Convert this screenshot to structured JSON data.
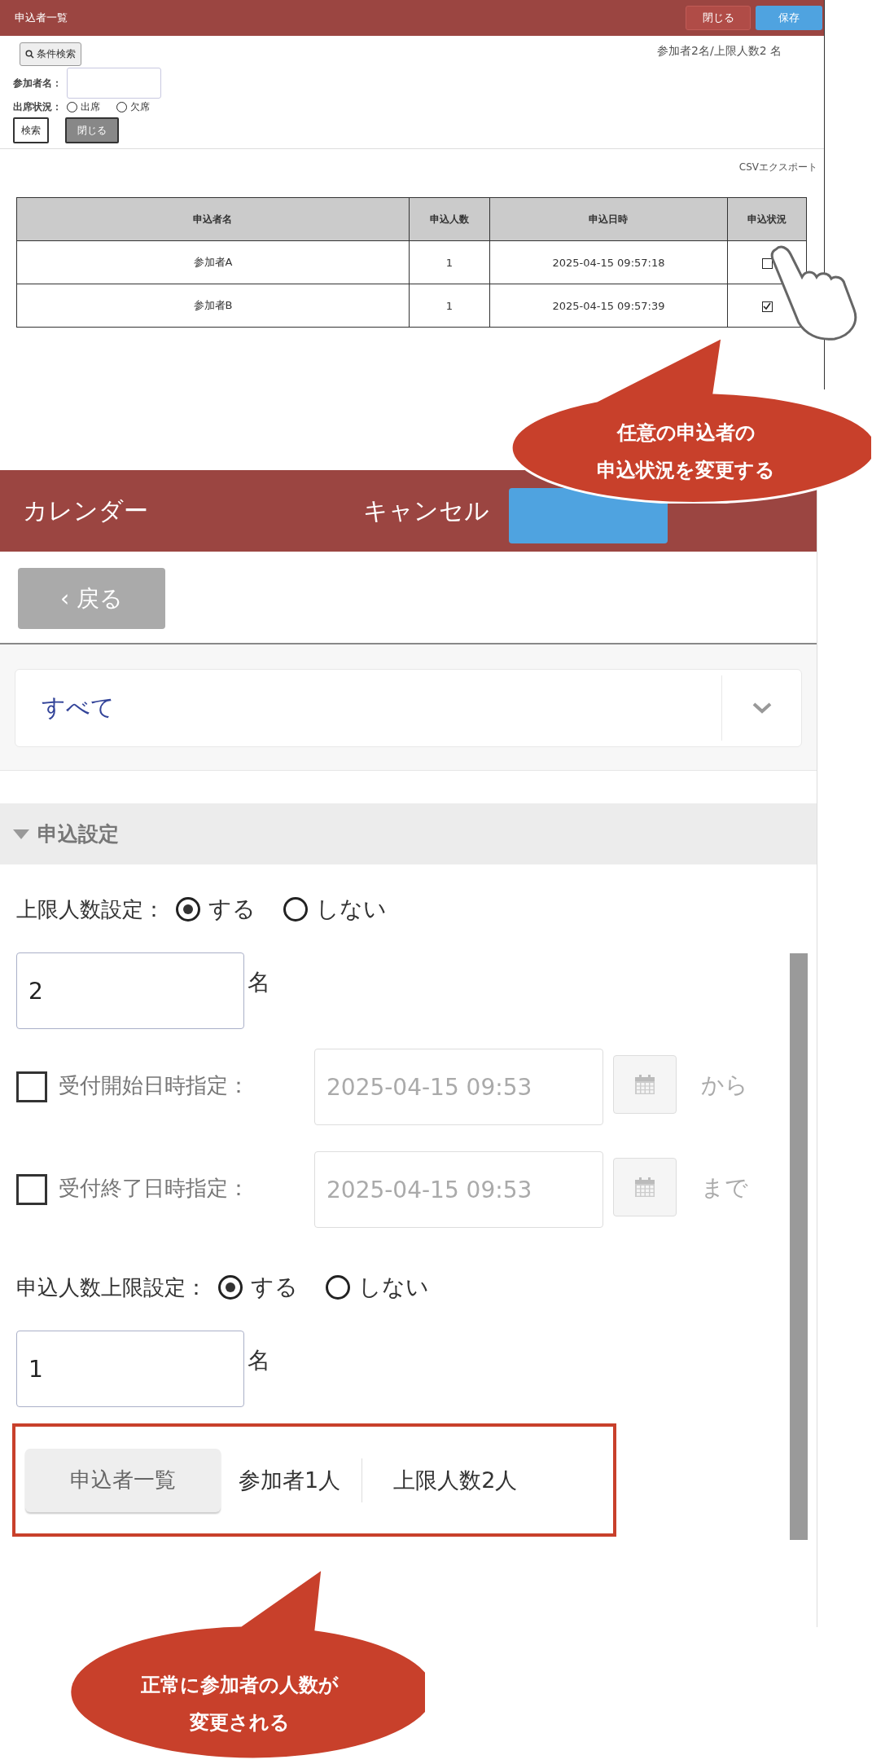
{
  "list_panel": {
    "title": "申込者一覧",
    "header_buttons": [
      {
        "label": "閉じる",
        "kind": "close"
      },
      {
        "label": "保存",
        "kind": "save"
      }
    ],
    "search_toggle": "条件検索",
    "summary": "参加者2名/上限人数2 名",
    "name_field": {
      "label": "参加者名："
    },
    "attendance": {
      "label": "出席状況：",
      "options": [
        {
          "label": "出席",
          "selected": false
        },
        {
          "label": "欠席",
          "selected": false
        }
      ]
    },
    "buttons": [
      {
        "label": "検索",
        "kind": "search"
      },
      {
        "label": "閉じる",
        "kind": "close"
      }
    ],
    "export_link": "CSVエクスポート",
    "table": {
      "columns": [
        "申込者名",
        "申込人数",
        "申込日時",
        "申込状況"
      ],
      "rows": [
        {
          "name": "参加者A",
          "count": "1",
          "datetime": "2025-04-15 09:57:18",
          "checked": false
        },
        {
          "name": "参加者B",
          "count": "1",
          "datetime": "2025-04-15 09:57:39",
          "checked": true
        }
      ]
    }
  },
  "calendar_panel": {
    "title": "カレンダー",
    "cancel": "キャンセル",
    "back": "‹ 戻る",
    "filter": {
      "value": "すべて"
    },
    "section": {
      "title": "申込設定",
      "expanded": true
    },
    "capacity": {
      "label": "上限人数設定：",
      "options": [
        {
          "label": "する",
          "selected": true
        },
        {
          "label": "しない",
          "selected": false
        }
      ],
      "value": "2",
      "unit": "名"
    },
    "date_rows": [
      {
        "label": "受付開始日時指定：",
        "checked": false,
        "value": "2025-04-15 09:53",
        "suffix": "から"
      },
      {
        "label": "受付終了日時指定：",
        "checked": false,
        "value": "2025-04-15 09:53",
        "suffix": "まで"
      }
    ],
    "applicant_limit": {
      "label": "申込人数上限設定：",
      "options": [
        {
          "label": "する",
          "selected": true
        },
        {
          "label": "しない",
          "selected": false
        }
      ],
      "value": "1",
      "unit": "名"
    },
    "summary_bar": {
      "button": "申込者一覧",
      "participants": "参加者1人",
      "limit": "上限人数2人"
    }
  },
  "callouts": [
    {
      "lines": [
        "任意の申込者の",
        "申込状況を変更する"
      ]
    },
    {
      "lines": [
        "正常に参加者の人数が",
        "変更される"
      ]
    }
  ]
}
